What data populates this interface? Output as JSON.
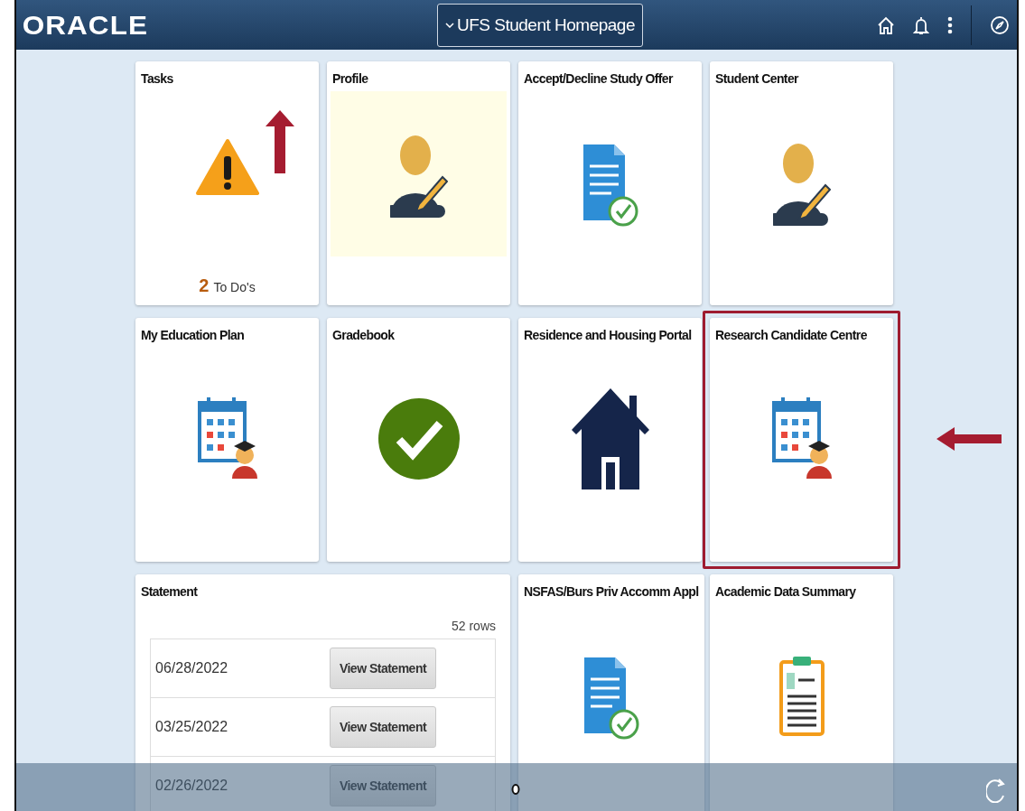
{
  "header": {
    "logo": "ORACLE",
    "title_menu": "UFS Student Homepage"
  },
  "tiles": [
    {
      "kind": "tasks",
      "title": "Tasks",
      "count": "2",
      "count_label": "To Do's",
      "highlighted": false
    },
    {
      "kind": "person",
      "shaded": true,
      "title": "Profile",
      "highlighted": false
    },
    {
      "kind": "document",
      "shaded": false,
      "title": "Accept/Decline Study Offer",
      "highlighted": false
    },
    {
      "kind": "person",
      "shaded": false,
      "title": "Student Center",
      "highlighted": false
    },
    {
      "kind": "calendar",
      "shaded": false,
      "title": "My Education Plan",
      "highlighted": false
    },
    {
      "kind": "check",
      "shaded": false,
      "title": "Gradebook",
      "highlighted": false
    },
    {
      "kind": "house",
      "shaded": false,
      "title": "Residence and Housing Portal",
      "highlighted": false
    },
    {
      "kind": "calendar",
      "shaded": false,
      "title": "Research Candidate Centre",
      "highlighted": true
    },
    {
      "kind": "statement",
      "title": "Statement",
      "row_count": "52 rows",
      "rows": [
        {
          "date": "06/28/2022",
          "button": "View Statement"
        },
        {
          "date": "03/25/2022",
          "button": "View Statement"
        },
        {
          "date": "02/26/2022",
          "button": "View Statement"
        }
      ]
    },
    {
      "kind": "document",
      "shaded": false,
      "title": "NSFAS/Burs Priv Accomm Appl",
      "highlighted": false
    },
    {
      "kind": "clipboard",
      "shaded": false,
      "title": "Academic Data Summary",
      "highlighted": false
    }
  ]
}
